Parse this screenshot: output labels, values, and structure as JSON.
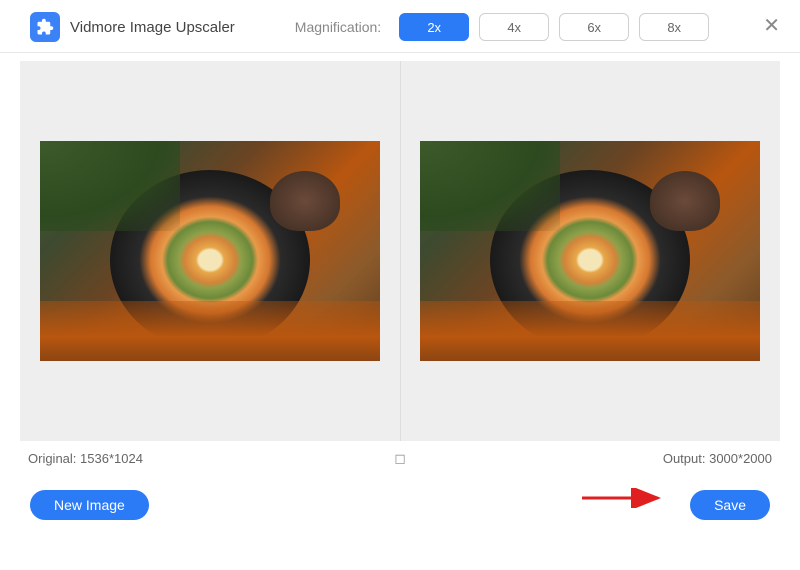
{
  "header": {
    "app_title": "Vidmore Image Upscaler",
    "magnification_label": "Magnification:",
    "mag_options": {
      "opt0": "2x",
      "opt1": "4x",
      "opt2": "6x",
      "opt3": "8x"
    },
    "active_mag_index": 0
  },
  "info": {
    "original_label": "Original: 1536*1024",
    "output_label": "Output: 3000*2000"
  },
  "buttons": {
    "new_image": "New Image",
    "save": "Save"
  },
  "colors": {
    "accent": "#2b7af6"
  }
}
